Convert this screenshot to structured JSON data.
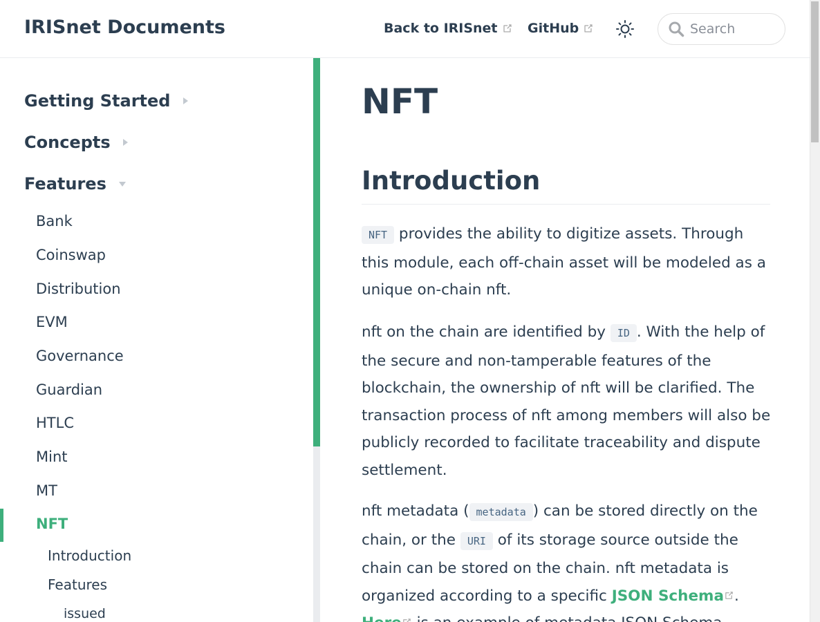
{
  "navbar": {
    "site_name": "IRISnet Documents",
    "links": [
      {
        "label": "Back to IRISnet",
        "icon": "external-link-icon"
      },
      {
        "label": "GitHub",
        "icon": "external-link-icon"
      }
    ],
    "theme_icon": "sun-icon",
    "search": {
      "placeholder": "Search",
      "value": "",
      "icon": "search-icon"
    }
  },
  "sidebar": {
    "groups": [
      {
        "label": "Getting Started",
        "expanded": false
      },
      {
        "label": "Concepts",
        "expanded": false
      },
      {
        "label": "Features",
        "expanded": true
      }
    ],
    "items": [
      "Bank",
      "Coinswap",
      "Distribution",
      "EVM",
      "Governance",
      "Guardian",
      "HTLC",
      "Mint",
      "MT",
      "NFT"
    ],
    "active_item": "NFT",
    "sub_items": [
      "Introduction",
      "Features"
    ],
    "sub_sub_items": [
      "issued"
    ]
  },
  "content": {
    "title": "NFT",
    "section_heading": "Introduction",
    "p1": {
      "code": "NFT",
      "text": " provides the ability to digitize assets. Through this module, each off-chain asset will be modeled as a unique on-chain nft."
    },
    "p2": {
      "before": "nft on the chain are identified by ",
      "code": "ID",
      "after": ". With the help of the secure and non-tamperable features of the blockchain, the ownership of nft will be clarified. The transaction process of nft among members will also be publicly recorded to facilitate traceability and dispute settlement."
    },
    "p3": {
      "t1": "nft metadata (",
      "code1": "metadata",
      "t2": ") can be stored directly on the chain, or the ",
      "code2": "URI",
      "t3": " of its storage source outside the chain can be stored on the chain. nft metadata is organized according to a specific ",
      "link1": "JSON Schema",
      "t4": ". ",
      "link2": "Here",
      "t5": " is an example of metadata JSON Schema."
    }
  },
  "colors": {
    "accent": "#3eaf7c",
    "text": "#2c3e50",
    "code_bg": "#f0f2f5",
    "code_text": "#476582"
  }
}
